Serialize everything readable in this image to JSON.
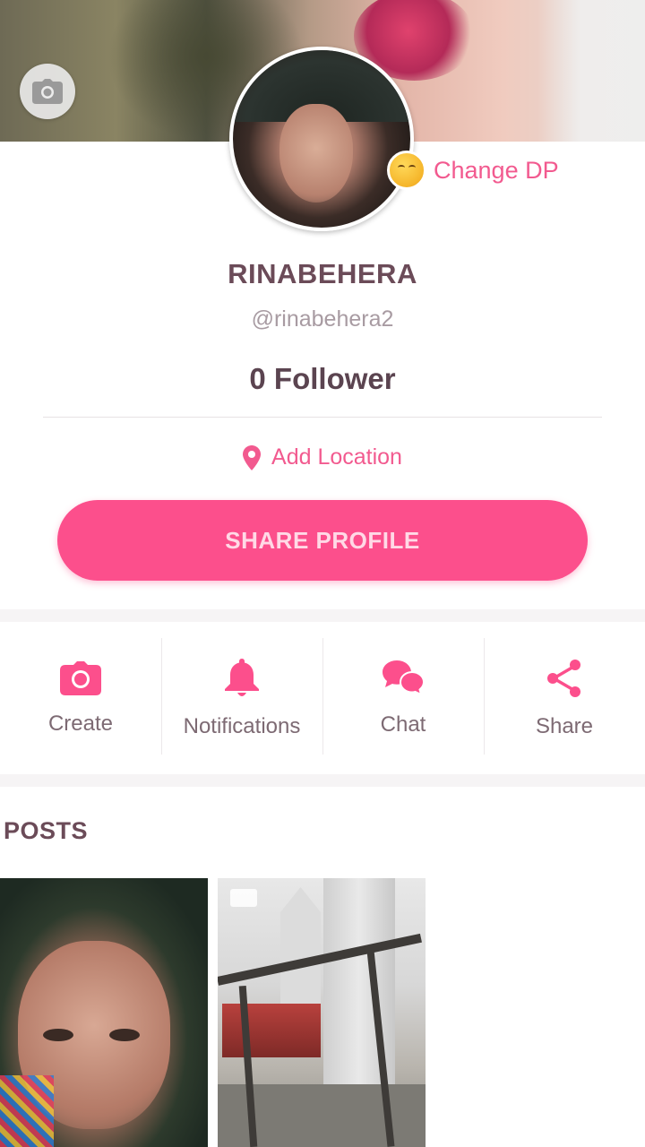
{
  "profile": {
    "name": "RINABEHERA",
    "handle": "@rinabehera2",
    "followers": "0 Follower",
    "change_dp_label": "Change DP",
    "location_label": "Add Location",
    "share_profile_label": "SHARE PROFILE"
  },
  "actions": [
    {
      "label": "Create",
      "icon": "camera-icon"
    },
    {
      "label": "Notifications",
      "icon": "bell-icon"
    },
    {
      "label": "Chat",
      "icon": "chat-bubbles-icon"
    },
    {
      "label": "Share",
      "icon": "share-icon"
    }
  ],
  "posts_section": {
    "title": "POSTS"
  },
  "colors": {
    "accent": "#fc4f8c",
    "accent_text": "#f25a8f",
    "title_text": "#6b4b58"
  }
}
